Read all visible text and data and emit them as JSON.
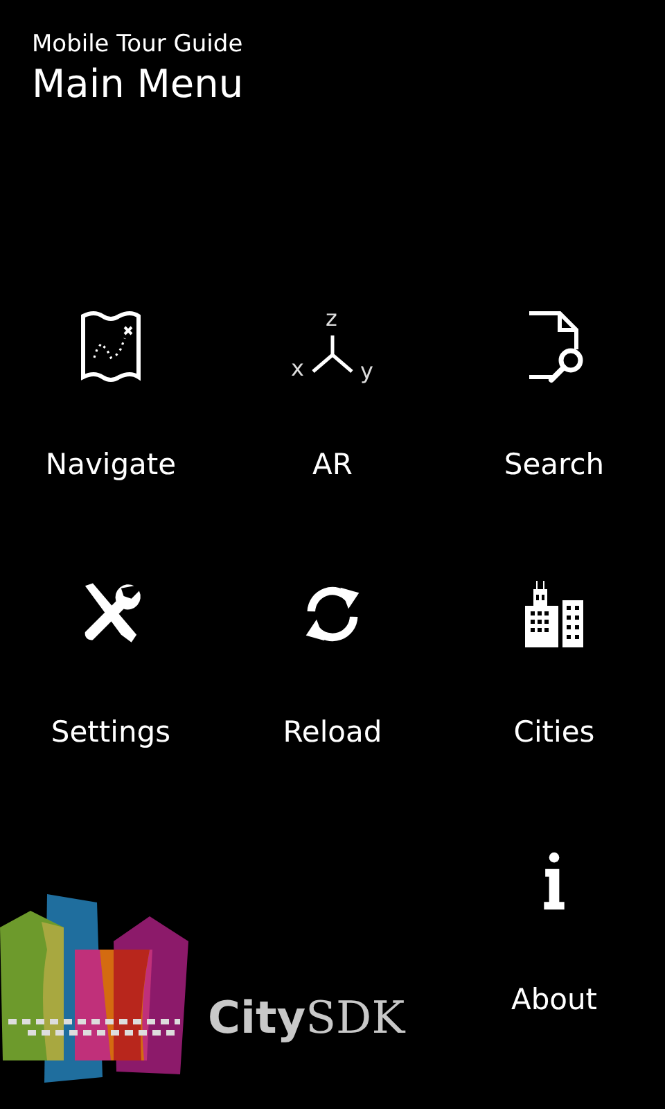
{
  "header": {
    "app_title": "Mobile Tour Guide",
    "page_title": "Main Menu"
  },
  "menu": [
    {
      "kind": "map",
      "label": "Navigate"
    },
    {
      "kind": "axes",
      "label": "AR",
      "axis_labels": [
        "z",
        "x",
        "y"
      ]
    },
    {
      "kind": "docsearch",
      "label": "Search"
    },
    {
      "kind": "tools",
      "label": "Settings"
    },
    {
      "kind": "refresh",
      "label": "Reload"
    },
    {
      "kind": "buildings",
      "label": "Cities"
    },
    {
      "kind": "info",
      "label": "About"
    }
  ],
  "logo": {
    "text": "**City**SDK"
  }
}
